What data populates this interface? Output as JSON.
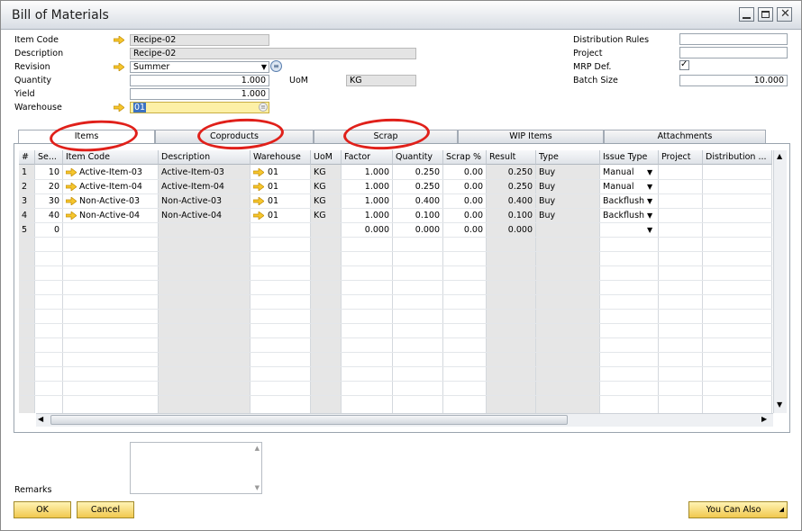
{
  "window": {
    "title": "Bill of Materials"
  },
  "header": {
    "item_code_label": "Item Code",
    "item_code": "Recipe-02",
    "description_label": "Description",
    "description": "Recipe-02",
    "revision_label": "Revision",
    "revision": "Summer",
    "quantity_label": "Quantity",
    "quantity": "1.000",
    "uom_label": "UoM",
    "uom": "KG",
    "yield_label": "Yield",
    "yield": "1.000",
    "warehouse_label": "Warehouse",
    "warehouse": "01",
    "distribution_rules_label": "Distribution Rules",
    "distribution_rules": "",
    "project_label": "Project",
    "project": "",
    "mrp_def_label": "MRP Def.",
    "mrp_def_checked": true,
    "batch_size_label": "Batch Size",
    "batch_size": "10.000"
  },
  "tabs": [
    "Items",
    "Coproducts",
    "Scrap",
    "WIP Items",
    "Attachments"
  ],
  "grid": {
    "columns": [
      "#",
      "Se...",
      "Item Code",
      "Description",
      "Warehouse",
      "UoM",
      "Factor",
      "Quantity",
      "Scrap %",
      "Result",
      "Type",
      "Issue Type",
      "Project",
      "Distribution ..."
    ],
    "rows": [
      {
        "num": "1",
        "seq": "10",
        "item_code": "Active-Item-03",
        "description": "Active-Item-03",
        "warehouse": "01",
        "uom": "KG",
        "factor": "1.000",
        "quantity": "0.250",
        "scrap": "0.00",
        "result": "0.250",
        "type": "Buy",
        "issue_type": "Manual"
      },
      {
        "num": "2",
        "seq": "20",
        "item_code": "Active-Item-04",
        "description": "Active-Item-04",
        "warehouse": "01",
        "uom": "KG",
        "factor": "1.000",
        "quantity": "0.250",
        "scrap": "0.00",
        "result": "0.250",
        "type": "Buy",
        "issue_type": "Manual"
      },
      {
        "num": "3",
        "seq": "30",
        "item_code": "Non-Active-03",
        "description": "Non-Active-03",
        "warehouse": "01",
        "uom": "KG",
        "factor": "1.000",
        "quantity": "0.400",
        "scrap": "0.00",
        "result": "0.400",
        "type": "Buy",
        "issue_type": "Backflush"
      },
      {
        "num": "4",
        "seq": "40",
        "item_code": "Non-Active-04",
        "description": "Non-Active-04",
        "warehouse": "01",
        "uom": "KG",
        "factor": "1.000",
        "quantity": "0.100",
        "scrap": "0.00",
        "result": "0.100",
        "type": "Buy",
        "issue_type": "Backflush"
      },
      {
        "num": "5",
        "seq": "0",
        "item_code": "",
        "description": "",
        "warehouse": "",
        "uom": "",
        "factor": "0.000",
        "quantity": "0.000",
        "scrap": "0.00",
        "result": "0.000",
        "type": "",
        "issue_type": ""
      }
    ]
  },
  "footer": {
    "remarks_label": "Remarks",
    "remarks": "",
    "ok_label": "OK",
    "cancel_label": "Cancel",
    "you_can_also_label": "You Can Also"
  },
  "colors": {
    "accent_orange": "#f1c84e",
    "highlight_red": "#e0201a",
    "readonly_gray": "#e4e4e4"
  },
  "icons": {
    "link_arrow": "arrow-right-icon",
    "dropdown": "chevron-down-icon",
    "list_button": "list-icon",
    "checkbox": "check-icon"
  }
}
